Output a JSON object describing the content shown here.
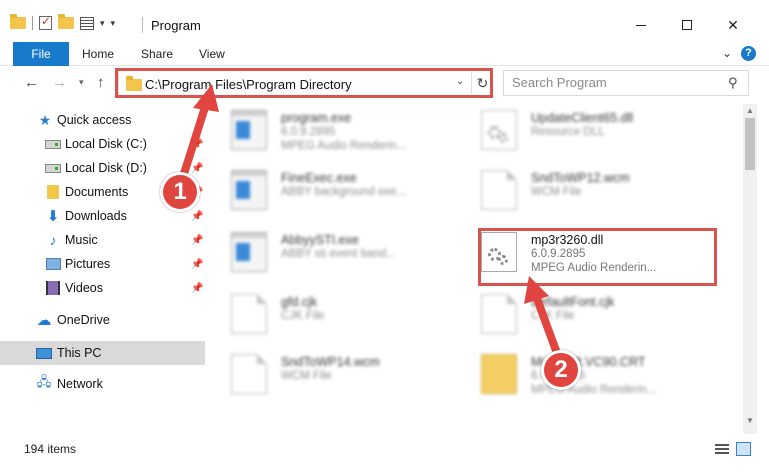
{
  "window": {
    "title": "Program",
    "minimize": "—",
    "close": "✕"
  },
  "ribbon": {
    "tabs": [
      {
        "label": "File"
      },
      {
        "label": "Home"
      },
      {
        "label": "Share"
      },
      {
        "label": "View"
      }
    ],
    "help": "?"
  },
  "address": {
    "path": "C:\\Program Files\\Program Directory",
    "refresh": "↻"
  },
  "search": {
    "placeholder": "Search Program",
    "icon": "⚲"
  },
  "nav": {
    "back": "←",
    "forward": "→",
    "up": "↑",
    "items": [
      {
        "label": "Quick access",
        "icon": "star-icon",
        "pinned": false
      },
      {
        "label": "Local Disk (C:)",
        "icon": "drive-icon",
        "pinned": true
      },
      {
        "label": "Local Disk (D:)",
        "icon": "drive-icon",
        "pinned": true
      },
      {
        "label": "Documents",
        "icon": "documents-folder-icon",
        "pinned": true
      },
      {
        "label": "Downloads",
        "icon": "download-icon",
        "pinned": true
      },
      {
        "label": "Music",
        "icon": "music-icon",
        "pinned": true
      },
      {
        "label": "Pictures",
        "icon": "pictures-icon",
        "pinned": true
      },
      {
        "label": "Videos",
        "icon": "videos-icon",
        "pinned": true
      },
      {
        "label": "OneDrive",
        "icon": "cloud-icon",
        "pinned": false
      },
      {
        "label": "This PC",
        "icon": "computer-icon",
        "pinned": false,
        "selected": true
      },
      {
        "label": "Network",
        "icon": "network-icon",
        "pinned": false
      }
    ]
  },
  "files": [
    {
      "name": "program.exe",
      "line2": "6.0.9.2895",
      "line3": "MPEG Audio Renderin...",
      "icon": "exe-icon"
    },
    {
      "name": "UpdateClient65.dll",
      "line2": "Resource DLL",
      "line3": "",
      "icon": "dll-icon"
    },
    {
      "name": "FineExec.exe",
      "line2": "ABBY background exe...",
      "line3": "",
      "icon": "exe-icon"
    },
    {
      "name": "SndToWP12.wcm",
      "line2": "WCM File",
      "line3": "",
      "icon": "document-icon"
    },
    {
      "name": "AbbyySTI.exe",
      "line2": "ABBY sti event band...",
      "line3": "",
      "icon": "exe-icon"
    },
    {
      "name": "mp3r3260.dll",
      "line2": "6.0.9.2895",
      "line3": "MPEG Audio Renderin...",
      "icon": "dll-icon"
    },
    {
      "name": "gfd.cjk",
      "line2": "CJK File",
      "line3": "",
      "icon": "document-icon"
    },
    {
      "name": "DefaultFont.cjk",
      "line2": "CJK File",
      "line3": "",
      "icon": "document-icon"
    },
    {
      "name": "SndToWP14.wcm",
      "line2": "WCM File",
      "line3": "",
      "icon": "document-icon"
    },
    {
      "name": "Microsoft.VC90.CRT",
      "line2": "6.0.9.2895",
      "line3": "MPEG Audio Renderin...",
      "icon": "folder-icon"
    }
  ],
  "status": {
    "items_count": "194 items"
  },
  "annotations": {
    "step1": "1",
    "step2": "2",
    "color": "#d9534f"
  }
}
